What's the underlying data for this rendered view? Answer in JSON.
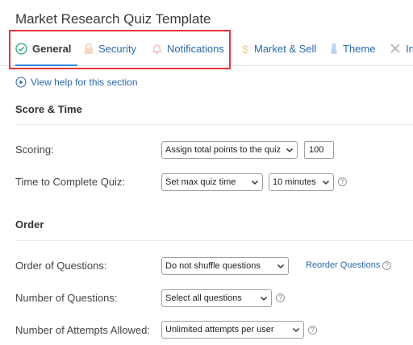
{
  "page": {
    "title": "Market Research Quiz Template"
  },
  "tabs": [
    {
      "label": "General",
      "icon": "check-circle-icon",
      "active": true
    },
    {
      "label": "Security",
      "icon": "lock-icon",
      "active": false
    },
    {
      "label": "Notifications",
      "icon": "bell-icon",
      "active": false
    },
    {
      "label": "Market & Sell",
      "icon": "dollar-icon",
      "active": false
    },
    {
      "label": "Theme",
      "icon": "brush-icon",
      "active": false
    },
    {
      "label": "In",
      "icon": "tools-icon",
      "active": false
    }
  ],
  "help": {
    "label": "View help for this section",
    "icon": "play-circle-icon"
  },
  "sections": {
    "score_time": {
      "title": "Score & Time",
      "scoring": {
        "label": "Scoring:",
        "select": "Assign total points to the quiz",
        "points": "100"
      },
      "time": {
        "label": "Time to Complete Quiz:",
        "mode": "Set max quiz time",
        "duration": "10 minutes"
      }
    },
    "order": {
      "title": "Order",
      "order_questions": {
        "label": "Order of Questions:",
        "select": "Do not shuffle questions",
        "link": "Reorder Questions"
      },
      "number_questions": {
        "label": "Number of Questions:",
        "select": "Select all questions"
      },
      "attempts": {
        "label": "Number of Attempts Allowed:",
        "select": "Unlimited attempts per user"
      }
    }
  },
  "colors": {
    "accent": "#2b8be0",
    "link": "#2a6ab0",
    "highlight": "#e8333a"
  }
}
